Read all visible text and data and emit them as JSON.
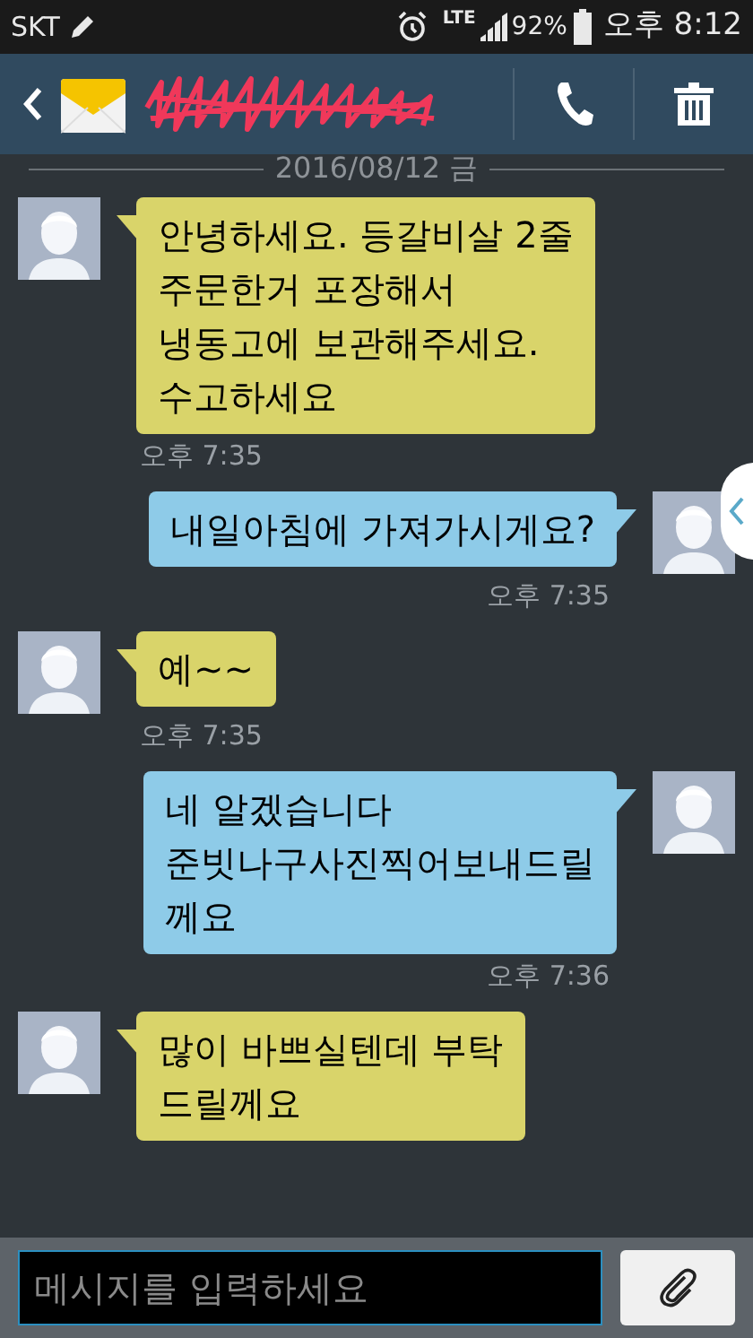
{
  "status_bar": {
    "carrier": "SKT",
    "network": "LTE",
    "battery": "92%",
    "time": "오후 8:12"
  },
  "header": {
    "contact_name_redacted": true
  },
  "date_divider": "2016/08/12 금",
  "messages": [
    {
      "kind": "incoming",
      "text": "안녕하세요. 등갈비살 2줄\n주문한거 포장해서\n냉동고에 보관해주세요.\n수고하세요",
      "time": "오후 7:35"
    },
    {
      "kind": "outgoing",
      "text": "내일아침에 가져가시게요?",
      "time": "오후 7:35"
    },
    {
      "kind": "incoming",
      "text": "예~~",
      "time": "오후 7:35"
    },
    {
      "kind": "outgoing",
      "text": "네 알겠습니다\n준빗나구사진찍어보내드릴\n께요",
      "time": "오후 7:36"
    },
    {
      "kind": "incoming",
      "text": "많이 바쁘실텐데 부탁\n드릴께요"
    }
  ],
  "composer": {
    "placeholder": "메시지를 입력하세요"
  }
}
